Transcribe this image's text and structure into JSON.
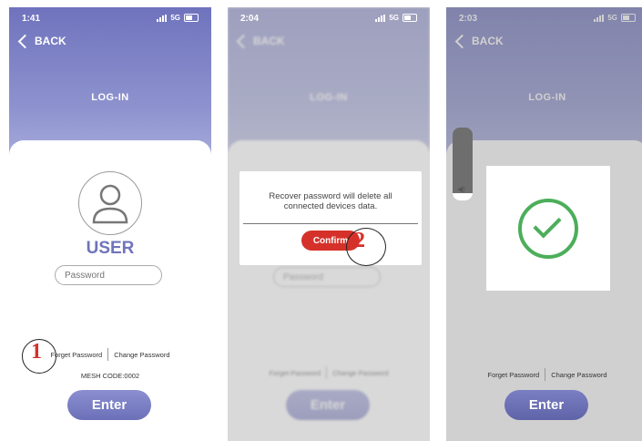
{
  "screens": [
    {
      "status": {
        "time": "1:41",
        "network": "5G"
      },
      "back_label": "BACK",
      "title": "LOG-IN",
      "avatar_label": "USER",
      "password_placeholder": "Password",
      "forgot_label": "Forget Password",
      "change_label": "Change Password",
      "mesh_code": "MESH CODE:0002",
      "enter_label": "Enter",
      "annotation": "1"
    },
    {
      "status": {
        "time": "2:04",
        "network": "5G"
      },
      "back_label": "BACK",
      "title": "LOG-IN",
      "password_placeholder": "Password",
      "forgot_label": "Forget Password",
      "change_label": "Change Password",
      "enter_label": "Enter",
      "dialog": {
        "message_line1": "Recover password will delete all",
        "message_line2": "connected devices data.",
        "confirm_label": "Confirm"
      },
      "annotation": "2"
    },
    {
      "status": {
        "time": "2:03",
        "network": "5G"
      },
      "back_label": "BACK",
      "title": "LOG-IN",
      "forgot_label": "Forget Password",
      "change_label": "Change Password",
      "enter_label": "Enter",
      "volume_level": 0.1
    }
  ],
  "colors": {
    "accent": "#6f74bb",
    "confirm": "#d5312a",
    "success": "#4cae5a"
  },
  "icons": [
    "chevron-left-icon",
    "user-icon",
    "signal-icon",
    "battery-icon",
    "check-circle-icon",
    "speaker-icon"
  ]
}
